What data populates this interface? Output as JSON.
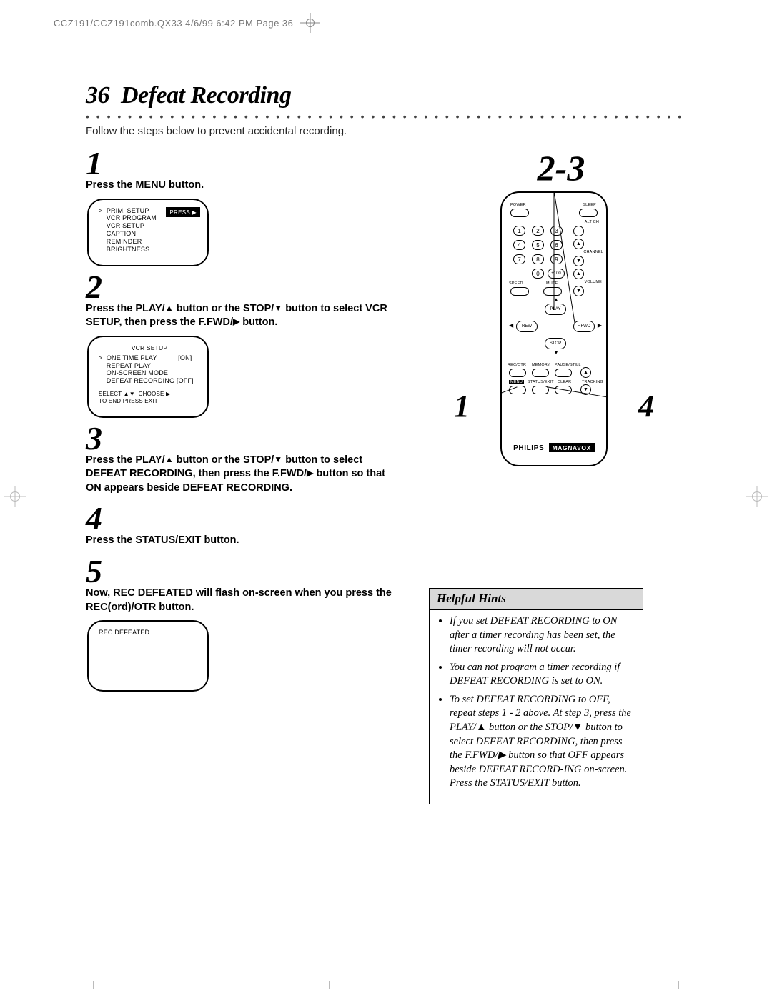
{
  "header": {
    "slug": "CCZ191/CCZ191comb.QX33  4/6/99 6:42 PM  Page 36"
  },
  "page": {
    "number": "36",
    "title": "Defeat Recording",
    "intro": "Follow the steps below to prevent accidental recording."
  },
  "steps": {
    "s1": {
      "num": "1",
      "text": "Press the MENU button."
    },
    "s2": {
      "num": "2",
      "text_a": "Press the PLAY/",
      "text_b": " button or the STOP/",
      "text_c": " button to select VCR SETUP, then press the F.FWD/",
      "text_d": " button."
    },
    "s3": {
      "num": "3",
      "text_a": "Press the PLAY/",
      "text_b": " button or the STOP/",
      "text_c": " button to select DEFEAT RECORDING, then press the F.FWD/",
      "text_d": " button so that ON appears beside DEFEAT RECORDING."
    },
    "s4": {
      "num": "4",
      "text": "Press the STATUS/EXIT button."
    },
    "s5": {
      "num": "5",
      "text": "Now, REC DEFEATED will flash on-screen when you press the REC(ord)/OTR button."
    }
  },
  "tv1": {
    "press_label": "PRESS ▶",
    "lines": [
      ">  PRIM. SETUP",
      "    VCR PROGRAM",
      "    VCR SETUP",
      "    CAPTION",
      "    REMINDER",
      "    BRIGHTNESS"
    ]
  },
  "tv2": {
    "title": "VCR SETUP",
    "lines": [
      ">  ONE TIME PLAY           [ON]",
      "    REPEAT PLAY",
      "    ON-SCREEN MODE",
      "    DEFEAT RECORDING [OFF]"
    ],
    "footer1": "SELECT ▲▼  CHOOSE ▶",
    "footer2": "TO END PRESS EXIT"
  },
  "tv3": {
    "text": "REC DEFEATED"
  },
  "pointers": {
    "top": "2-3",
    "left": "1",
    "right": "4"
  },
  "remote": {
    "labels": {
      "power": "POWER",
      "sleep": "SLEEP",
      "altch": "ALT CH",
      "channel": "CHANNEL",
      "speed": "SPEED",
      "mute": "MUTE",
      "volume": "VOLUME",
      "play": "PLAY",
      "rew": "REW",
      "ffwd": "F.FWD",
      "stop": "STOP",
      "rec": "REC/OTR",
      "memory": "MEMORY",
      "pause": "PAUSE/STILL",
      "menu": "MENU",
      "status": "STATUS/EXIT",
      "clear": "CLEAR",
      "tracking": "TRACKING"
    },
    "keypad": [
      "1",
      "2",
      "3",
      "4",
      "5",
      "6",
      "7",
      "8",
      "9",
      "0",
      "+100"
    ],
    "brand1": "PHILIPS",
    "brand2": "MAGNAVOX"
  },
  "hints": {
    "title": "Helpful Hints",
    "items": [
      "If you set DEFEAT RECORDING to ON after a timer recording has been set, the timer recording will not occur.",
      "You can not program a timer recording if DEFEAT RECORDING is set to ON.",
      "To set DEFEAT RECORDING to OFF, repeat steps 1 - 2 above. At step 3, press the PLAY/▲ button or the STOP/▼ button to select DEFEAT RECORDING, then press the F.FWD/▶ button so that OFF appears beside DEFEAT RECORD-ING on-screen. Press the STATUS/EXIT button."
    ]
  }
}
